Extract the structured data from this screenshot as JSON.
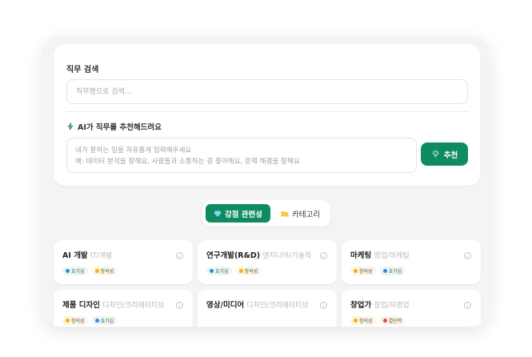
{
  "search": {
    "title": "직무 검색",
    "placeholder": "직무명으로 검색..."
  },
  "ai": {
    "title": "AI가 직무를 추천해드려요",
    "placeholder_line1": "내가 잘하는 일을 자유롭게 입력해주세요",
    "placeholder_line2": "예: 데이터 분석을 잘해요, 사람들과 소통하는 걸 좋아해요, 문제 해결을 잘해요",
    "button_label": "추천"
  },
  "tabs": {
    "active": "강점 관련성",
    "inactive": "카테고리"
  },
  "jobs": [
    {
      "title": "AI 개발",
      "category": "IT/개발",
      "tags": [
        {
          "label": "호기심",
          "color": "#3b82f6"
        },
        {
          "label": "창의성",
          "color": "#f5b301"
        }
      ]
    },
    {
      "title": "연구개발(R&D)",
      "category": "엔지니어/기술직",
      "tags": [
        {
          "label": "호기심",
          "color": "#3b82f6"
        },
        {
          "label": "창의성",
          "color": "#f5b301"
        }
      ]
    },
    {
      "title": "마케팅",
      "category": "영업/마케팅",
      "tags": [
        {
          "label": "창의성",
          "color": "#f5b301"
        },
        {
          "label": "호기심",
          "color": "#3b82f6"
        }
      ]
    },
    {
      "title": "제품 디자인",
      "category": "디자인/크리에이티브",
      "tags": [
        {
          "label": "창의성",
          "color": "#f5b301"
        },
        {
          "label": "호기심",
          "color": "#3b82f6"
        }
      ]
    },
    {
      "title": "영상/미디어",
      "category": "디자인/크리에이티브",
      "tags": []
    },
    {
      "title": "창업가",
      "category": "창업/자영업",
      "tags": [
        {
          "label": "창의성",
          "color": "#f5b301"
        },
        {
          "label": "결단력",
          "color": "#ef4444"
        }
      ]
    }
  ],
  "colors": {
    "accent": "#0f8c5f"
  }
}
